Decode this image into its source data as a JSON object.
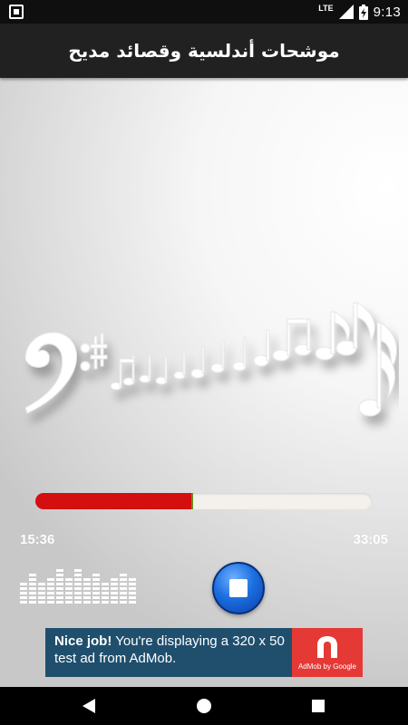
{
  "status_bar": {
    "network_type": "LTE",
    "time": "9:13",
    "icons": [
      "notification-icon",
      "signal-icon",
      "battery-charging-icon"
    ]
  },
  "app_bar": {
    "title": "موشحات أندلسية وقصائد مديح"
  },
  "player": {
    "elapsed_time": "15:36",
    "total_time": "33:05",
    "progress_fraction": 0.47,
    "progress_color": "#d40f0f",
    "control_button_icon": "stop-icon",
    "control_button_color": "#1c6fe0",
    "equalizer_levels": [
      5,
      7,
      5,
      6,
      8,
      6,
      8,
      6,
      7,
      5,
      6,
      7,
      6
    ]
  },
  "ad": {
    "bold_text": "Nice job!",
    "body_text": " You're displaying a 320 x 50 test ad from AdMob.",
    "logo_text": "AdMob by Google",
    "background_color": "#1f4f6d",
    "logo_color": "#e53935"
  },
  "nav_bar": {
    "buttons": [
      "back-icon",
      "home-icon",
      "recent-apps-icon"
    ]
  }
}
